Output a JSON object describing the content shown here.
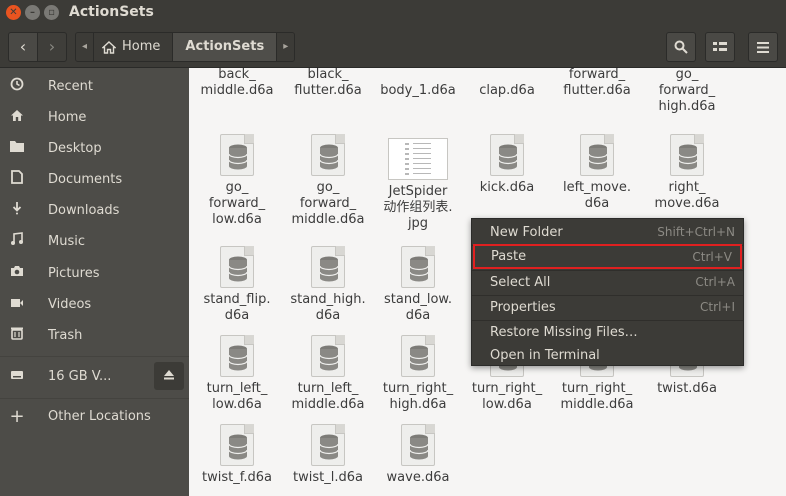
{
  "window": {
    "title": "ActionSets"
  },
  "header": {
    "back_label": "‹",
    "forward_label": "›",
    "breadcrumb_left_arrow": "◂",
    "breadcrumb_home": "Home",
    "breadcrumb_current": "ActionSets",
    "breadcrumb_right_arrow": "▸"
  },
  "sidebar": {
    "items": [
      {
        "label": "Recent",
        "icon": "clock-icon"
      },
      {
        "label": "Home",
        "icon": "home-icon"
      },
      {
        "label": "Desktop",
        "icon": "folder-icon"
      },
      {
        "label": "Documents",
        "icon": "document-icon"
      },
      {
        "label": "Downloads",
        "icon": "download-icon"
      },
      {
        "label": "Music",
        "icon": "music-icon"
      },
      {
        "label": "Pictures",
        "icon": "camera-icon"
      },
      {
        "label": "Videos",
        "icon": "video-icon"
      },
      {
        "label": "Trash",
        "icon": "trash-icon"
      },
      {
        "label": "16 GB V...",
        "icon": "drive-icon"
      },
      {
        "label": "Other Locations",
        "icon": "plus-icon"
      }
    ]
  },
  "files": [
    {
      "name": "back_\nmiddle.d6a"
    },
    {
      "name": "black_\nflutter.d6a"
    },
    {
      "name": "body_1.d6a"
    },
    {
      "name": "clap.d6a"
    },
    {
      "name": "forward_\nflutter.d6a"
    },
    {
      "name": "go_\nforward_\nhigh.d6a"
    },
    {
      "name": "go_\nforward_\nlow.d6a"
    },
    {
      "name": "go_\nforward_\nmiddle.d6a"
    },
    {
      "name": "JetSpider\n动作组列表.\njpg"
    },
    {
      "name": "kick.d6a"
    },
    {
      "name": "left_move.\nd6a"
    },
    {
      "name": "right_\nmove.d6a"
    },
    {
      "name": "stand_flip.\nd6a"
    },
    {
      "name": "stand_high.\nd6a"
    },
    {
      "name": "stand_low.\nd6a"
    },
    {
      "name": "turn_left_\nlow.d6a"
    },
    {
      "name": "turn_left_\nmiddle.d6a"
    },
    {
      "name": "turn_right_\nhigh.d6a"
    },
    {
      "name": "turn_right_\nlow.d6a"
    },
    {
      "name": "turn_right_\nmiddle.d6a"
    },
    {
      "name": "twist.d6a"
    },
    {
      "name": "twist_f.d6a"
    },
    {
      "name": "twist_l.d6a"
    },
    {
      "name": "wave.d6a"
    }
  ],
  "context_menu": {
    "items": [
      {
        "label": "New Folder",
        "accel": "Shift+Ctrl+N"
      },
      {
        "label": "Paste",
        "accel": "Ctrl+V"
      },
      {
        "label": "Select All",
        "accel": "Ctrl+A"
      },
      {
        "label": "Properties",
        "accel": "Ctrl+I"
      },
      {
        "label": "Restore Missing Files…",
        "accel": ""
      },
      {
        "label": "Open in Terminal",
        "accel": ""
      }
    ]
  },
  "colors": {
    "titlebar": "#3c3b37",
    "sidebar": "#4d4c48",
    "accent": "#e95420",
    "highlight_border": "#e02020"
  }
}
